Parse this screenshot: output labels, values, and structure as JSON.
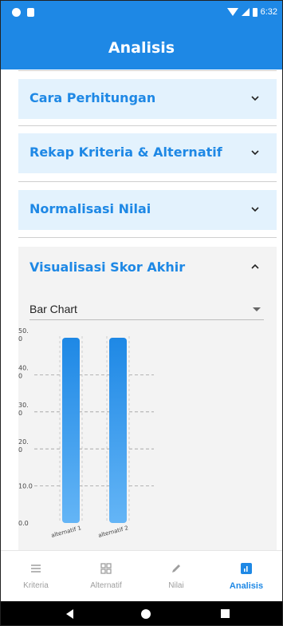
{
  "statusbar": {
    "time": "6:32"
  },
  "appbar": {
    "title": "Analisis"
  },
  "sections": [
    {
      "title": "Cara Perhitungan",
      "expanded": false
    },
    {
      "title": "Rekap Kriteria & Alternatif",
      "expanded": false
    },
    {
      "title": "Normalisasi Nilai",
      "expanded": false
    },
    {
      "title": "Visualisasi Skor Akhir",
      "expanded": true
    }
  ],
  "visualisasi": {
    "dropdown_value": "Bar Chart"
  },
  "chart_data": {
    "type": "bar",
    "categories": [
      "alternatif 1",
      "alternatif 2"
    ],
    "values": [
      50.0,
      50.0
    ],
    "ylim": [
      0,
      50
    ],
    "ytick_labels": [
      "0.0",
      "10.0",
      "20.\n0",
      "30.\n0",
      "40.\n0",
      "50.\n0"
    ],
    "yticks": [
      0,
      10,
      20,
      30,
      40,
      50
    ],
    "grid": true,
    "bar_color_top": "#1e88e5",
    "bar_color_bottom": "#64b5f6"
  },
  "bottomnav": [
    {
      "label": "Kriteria",
      "icon": "list-icon",
      "active": false
    },
    {
      "label": "Alternatif",
      "icon": "grid-icon",
      "active": false
    },
    {
      "label": "Nilai",
      "icon": "pencil-icon",
      "active": false
    },
    {
      "label": "Analisis",
      "icon": "chart-icon",
      "active": true
    }
  ],
  "colors": {
    "primary": "#1e88e5",
    "panel_bg": "#e3f2fd",
    "inactive": "#9e9e9e"
  }
}
